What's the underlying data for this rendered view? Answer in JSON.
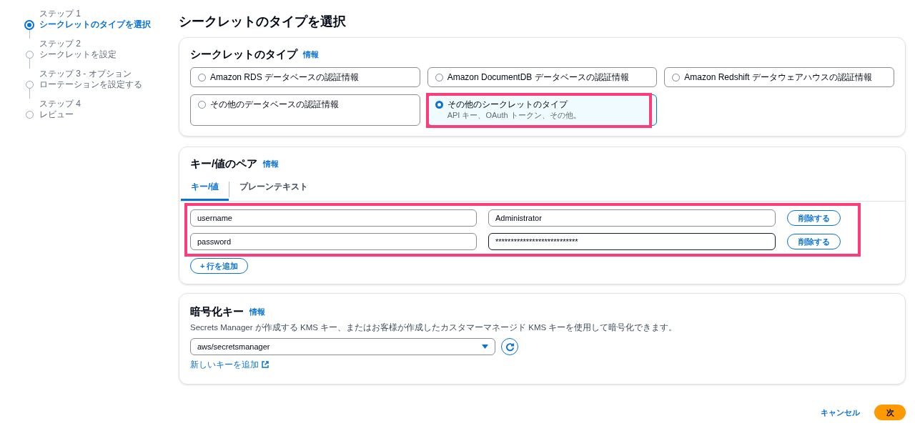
{
  "steps": [
    {
      "label": "ステップ 1",
      "title": "シークレットのタイプを選択",
      "selected": true
    },
    {
      "label": "ステップ 2",
      "title": "シークレットを設定",
      "selected": false
    },
    {
      "label": "ステップ 3 - オプション",
      "title": "ローテーションを設定する",
      "selected": false
    },
    {
      "label": "ステップ 4",
      "title": "レビュー",
      "selected": false
    }
  ],
  "page_title": "シークレットのタイプを選択",
  "secret_type": {
    "heading": "シークレットのタイプ",
    "info": "情報",
    "options": [
      {
        "title": "Amazon RDS データベースの認証情報",
        "selected": false,
        "highlighted": false
      },
      {
        "title": "Amazon DocumentDB データベースの認証情報",
        "selected": false,
        "highlighted": false
      },
      {
        "title": "Amazon Redshift データウェアハウスの認証情報",
        "selected": false,
        "highlighted": false
      },
      {
        "title": "その他のデータベースの認証情報",
        "selected": false,
        "highlighted": false
      },
      {
        "title": "その他のシークレットのタイプ",
        "description": "API キー、OAuth トークン、その他。",
        "selected": true,
        "highlighted": true
      }
    ]
  },
  "key_value": {
    "heading": "キー/値のペア",
    "info": "情報",
    "tabs": [
      {
        "label": "キー/値",
        "selected": true
      },
      {
        "label": "プレーンテキスト",
        "selected": false
      }
    ],
    "highlighted": true,
    "rows": [
      {
        "key": "username",
        "value": "Administrator",
        "focused": false,
        "remove": "削除する"
      },
      {
        "key": "password",
        "value": "***************************",
        "focused": true,
        "remove": "削除する"
      }
    ],
    "add_row": "+ 行を追加"
  },
  "encryption": {
    "heading": "暗号化キー",
    "info": "情報",
    "description": "Secrets Manager が作成する KMS キー、またはお客様が作成したカスタマーマネージド KMS キーを使用して暗号化できます。",
    "select": {
      "value": "aws/secretsmanager"
    },
    "link": "新しいキーを追加"
  },
  "footer": {
    "cancel": "キャンセル",
    "next": "次"
  }
}
